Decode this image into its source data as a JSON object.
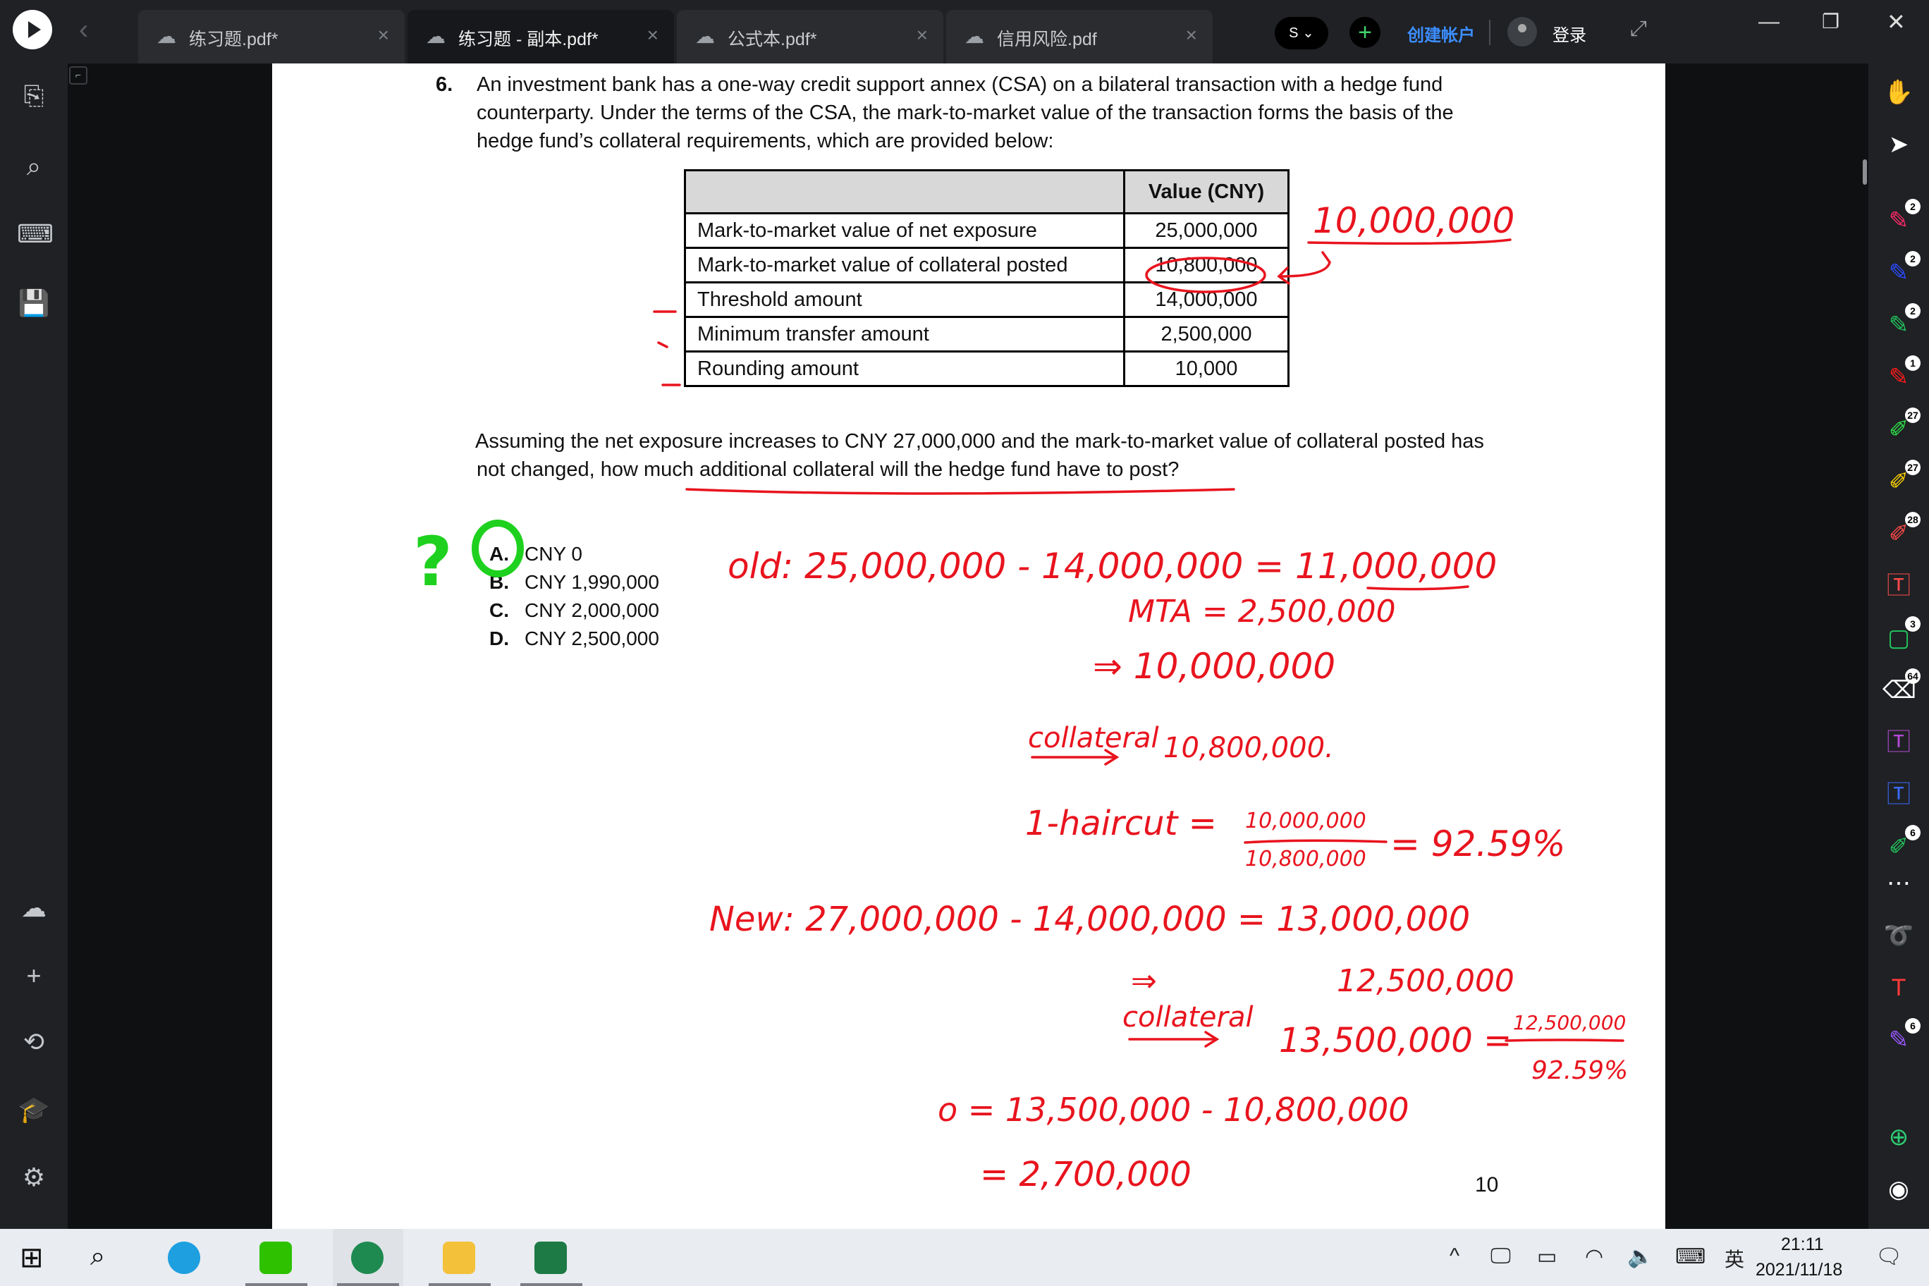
{
  "tabs": [
    {
      "label": "练习题.pdf*"
    },
    {
      "label": "练习题 - 副本.pdf*",
      "active": true
    },
    {
      "label": "公式本.pdf*"
    },
    {
      "label": "信用风险.pdf"
    }
  ],
  "topbar": {
    "s_chip": "S",
    "create_account": "创建帐户",
    "login": "登录"
  },
  "question": {
    "number": "6.",
    "intro_lines": [
      "An investment bank has a one-way credit support annex (CSA) on a bilateral transaction with a hedge fund",
      "counterparty. Under the terms of the CSA, the mark-to-market value of the transaction forms the basis of the",
      "hedge fund’s collateral requirements, which are provided below:"
    ],
    "table": {
      "header": "Value (CNY)",
      "rows": [
        {
          "label": "Mark-to-market value of net exposure",
          "value": "25,000,000"
        },
        {
          "label": "Mark-to-market value of collateral posted",
          "value": "10,800,000"
        },
        {
          "label": "Threshold amount",
          "value": "14,000,000"
        },
        {
          "label": "Minimum transfer amount",
          "value": "2,500,000"
        },
        {
          "label": "Rounding amount",
          "value": "10,000"
        }
      ]
    },
    "prompt_lines": [
      "Assuming the net exposure increases to CNY 27,000,000 and the mark-to-market value of collateral posted has",
      "not changed, how much additional collateral will the hedge fund have to post?"
    ],
    "options": [
      {
        "letter": "A.",
        "text": "CNY 0"
      },
      {
        "letter": "B.",
        "text": "CNY 1,990,000"
      },
      {
        "letter": "C.",
        "text": "CNY 2,000,000"
      },
      {
        "letter": "D.",
        "text": "CNY 2,500,000"
      }
    ],
    "page_number": "10"
  },
  "annotations": {
    "question_mark": "?",
    "top_right": "10,000,000",
    "lines": [
      "old: 25,000,000 - 14,000,000 = 11,000,000",
      "MTA = 2,500,000",
      "⇒ 10,000,000",
      "collateral",
      "10,800,000.",
      "1-haircut =",
      "10,000,000",
      "10,800,000",
      "= 92.59%",
      "New: 27,000,000 - 14,000,000 = 13,000,000",
      "⇒",
      "12,500,000",
      "collateral",
      "13,500,000 =",
      "12,500,000",
      "92.59%",
      "o = 13,500,000 - 10,800,000",
      "= 2,700,000"
    ],
    "ink_red": "#e8141e",
    "ink_green": "#1ed11e"
  },
  "right_toolbar_badges": [
    "2",
    "2",
    "2",
    "1",
    "27",
    "27",
    "28",
    "3",
    "64",
    "6",
    "6"
  ],
  "taskbar": {
    "time": "21:11",
    "date": "2021/11/18",
    "ime": "英"
  }
}
